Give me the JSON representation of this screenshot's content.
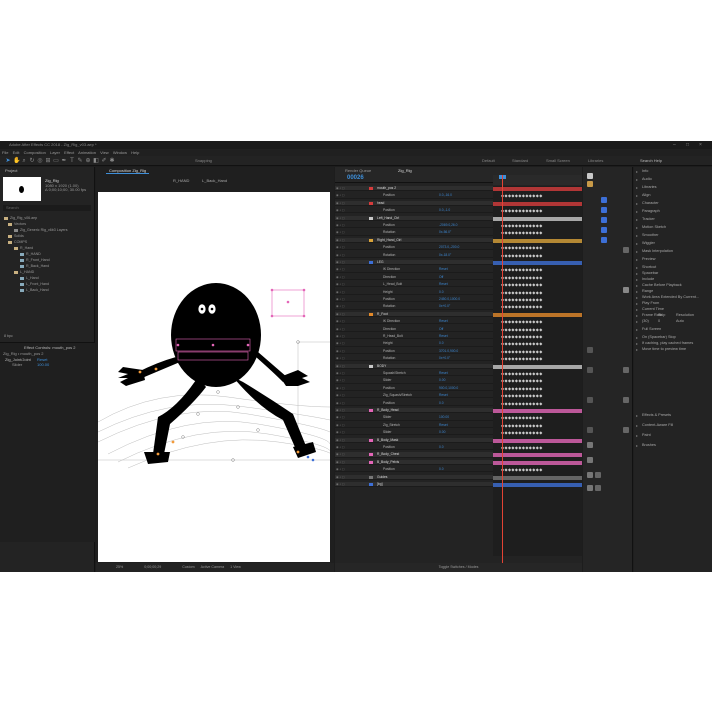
{
  "window": {
    "title": "Adobe After Effects CC 2018 - Zig_Rig_v03.aep *"
  },
  "menu": [
    "File",
    "Edit",
    "Composition",
    "Layer",
    "Effect",
    "Animation",
    "View",
    "Window",
    "Help"
  ],
  "toolbar": {
    "snapping": "Snapping",
    "workspaces": [
      "Default",
      "Standard",
      "Small Screen",
      "Libraries"
    ],
    "search": "Search Help"
  },
  "project": {
    "tab": "Project",
    "tab2": "Effect Controls",
    "comp_name": "Zig_Rig",
    "comp_info": [
      "1080 x 1920 (1.00)",
      "Δ 0;00;10;00, 30.00 fps"
    ],
    "search_placeholder": "Search",
    "items": [
      "Zig_Rig_v06.aep",
      "Vectors",
      "Zig_Generic Rig_v6b3 Layers",
      "Solids",
      "COMPS",
      "R_Hand",
      "R_HAND",
      "R_Front_Hand",
      "R_Back_Hand",
      "L_HAND",
      "L_Hand",
      "L_Front_Hand",
      "L_Back_Hand"
    ],
    "footer": "8 bpc"
  },
  "controls": {
    "header": "Effect Controls: mouth_pos 2",
    "layer": "Zig_Rig • mouth_pos 2",
    "effect": "Zig_Joint/Joint",
    "slider_label": "Slider",
    "reset": "Reset",
    "value": "100.00"
  },
  "viewer": {
    "tabs": [
      "Composition Zig_Rig",
      "R_HAND",
      "L_Back_Hand"
    ],
    "zoom": "25%",
    "timecode": "0;00;00;29",
    "resolution": "Custom",
    "camera": "Active Camera",
    "views": "1 View"
  },
  "timeline": {
    "tab": "Render Queue",
    "comp_tab": "Zig_Rig",
    "timecode": "00026",
    "footer": "Toggle Switches / Modes",
    "layers": [
      {
        "name": "mouth_pos 2",
        "layer": true,
        "color": "#d63c3c"
      },
      {
        "name": "Position",
        "value": "0.0,-16.0"
      },
      {
        "name": "head",
        "layer": true,
        "color": "#d63c3c"
      },
      {
        "name": "Position",
        "value": "0.0,-1.0"
      },
      {
        "name": "Left_Hand_Ctrl",
        "layer": true,
        "color": "#c9c9c9"
      },
      {
        "name": "Position",
        "value": "-2069.0,26.0"
      },
      {
        "name": "Rotation",
        "value": "0x-56.0°"
      },
      {
        "name": "Right_Hand_Ctrl",
        "layer": true,
        "color": "#d9a33a"
      },
      {
        "name": "Position",
        "value": "2073.0,-200.0"
      },
      {
        "name": "Rotation",
        "value": "0x-18.0°"
      },
      {
        "name": "LEG",
        "layer": true,
        "color": "#3d6fd6"
      },
      {
        "name": "IK Direction",
        "value": "Reset"
      },
      {
        "name": "Direction",
        "value": "Off"
      },
      {
        "name": "L_Head_Bolt",
        "value": "Reset"
      },
      {
        "name": "Height",
        "value": "0.0"
      },
      {
        "name": "Position",
        "value": "2450.0,1000.0"
      },
      {
        "name": "Rotation",
        "value": "0x+0.0°"
      },
      {
        "name": "R_Foot",
        "layer": true,
        "color": "#e38a2a"
      },
      {
        "name": "IK Direction",
        "value": "Reset"
      },
      {
        "name": "Direction",
        "value": "Off"
      },
      {
        "name": "R_Head_Bolt",
        "value": "Reset"
      },
      {
        "name": "Height",
        "value": "0.0"
      },
      {
        "name": "Position",
        "value": "3701.0,900.0"
      },
      {
        "name": "Rotation",
        "value": "0x+0.0°"
      },
      {
        "name": "BODY",
        "layer": true,
        "color": "#c9c9c9"
      },
      {
        "name": "Squash/Stretch",
        "value": "Reset"
      },
      {
        "name": "Slider",
        "value": "0.00"
      },
      {
        "name": "Position",
        "value": "900.0,1000.0"
      },
      {
        "name": "Zig_Squash/Stretch",
        "value": "Reset"
      },
      {
        "name": "Position",
        "value": "0.0"
      },
      {
        "name": "R_Body_Head",
        "layer": true,
        "color": "#e466b8"
      },
      {
        "name": "Slider",
        "value": "100.00"
      },
      {
        "name": "Zig_Stretch",
        "value": "Reset"
      },
      {
        "name": "Slider",
        "value": "0.00"
      },
      {
        "name": "B_Body_Mask",
        "layer": true,
        "color": "#e466b8"
      },
      {
        "name": "Position",
        "value": "0.0"
      },
      {
        "name": "R_Body_Chest",
        "layer": true,
        "color": "#e466b8"
      },
      {
        "name": "B_Body_Pelvis",
        "layer": true,
        "color": "#e466b8"
      },
      {
        "name": "Position",
        "value": "0.0"
      },
      {
        "name": "Guides",
        "layer": true,
        "color": "#777777"
      },
      {
        "name": "[bg]",
        "layer": true,
        "color": "#3d6fd6"
      }
    ]
  },
  "effects_panel": {
    "items": [
      "Info",
      "Audio",
      "Libraries",
      "Align",
      "Character",
      "Paragraph",
      "Tracker",
      "Motion Sketch",
      "Smoother",
      "Wiggler",
      "Mask Interpolation",
      "Preview",
      "Shortcut",
      "Spacebar",
      "Include",
      "Cache Before Playback",
      "Range",
      "Work Area Extended By Current...",
      "Play From",
      "Current Time",
      "Frame Rate",
      "Skip",
      "Resolution",
      "(30)",
      "0",
      "Auto",
      "Full Screen",
      "On (Spacebar) Stop",
      "If caching, play cached frames",
      "Move time to preview time",
      "Effects & Presets",
      "Content-Aware Fill",
      "Paint",
      "Brushes"
    ]
  },
  "colors": {
    "accent": "#3e8fd9",
    "playhead": "#e34334",
    "bg": "#1d1d1d"
  }
}
